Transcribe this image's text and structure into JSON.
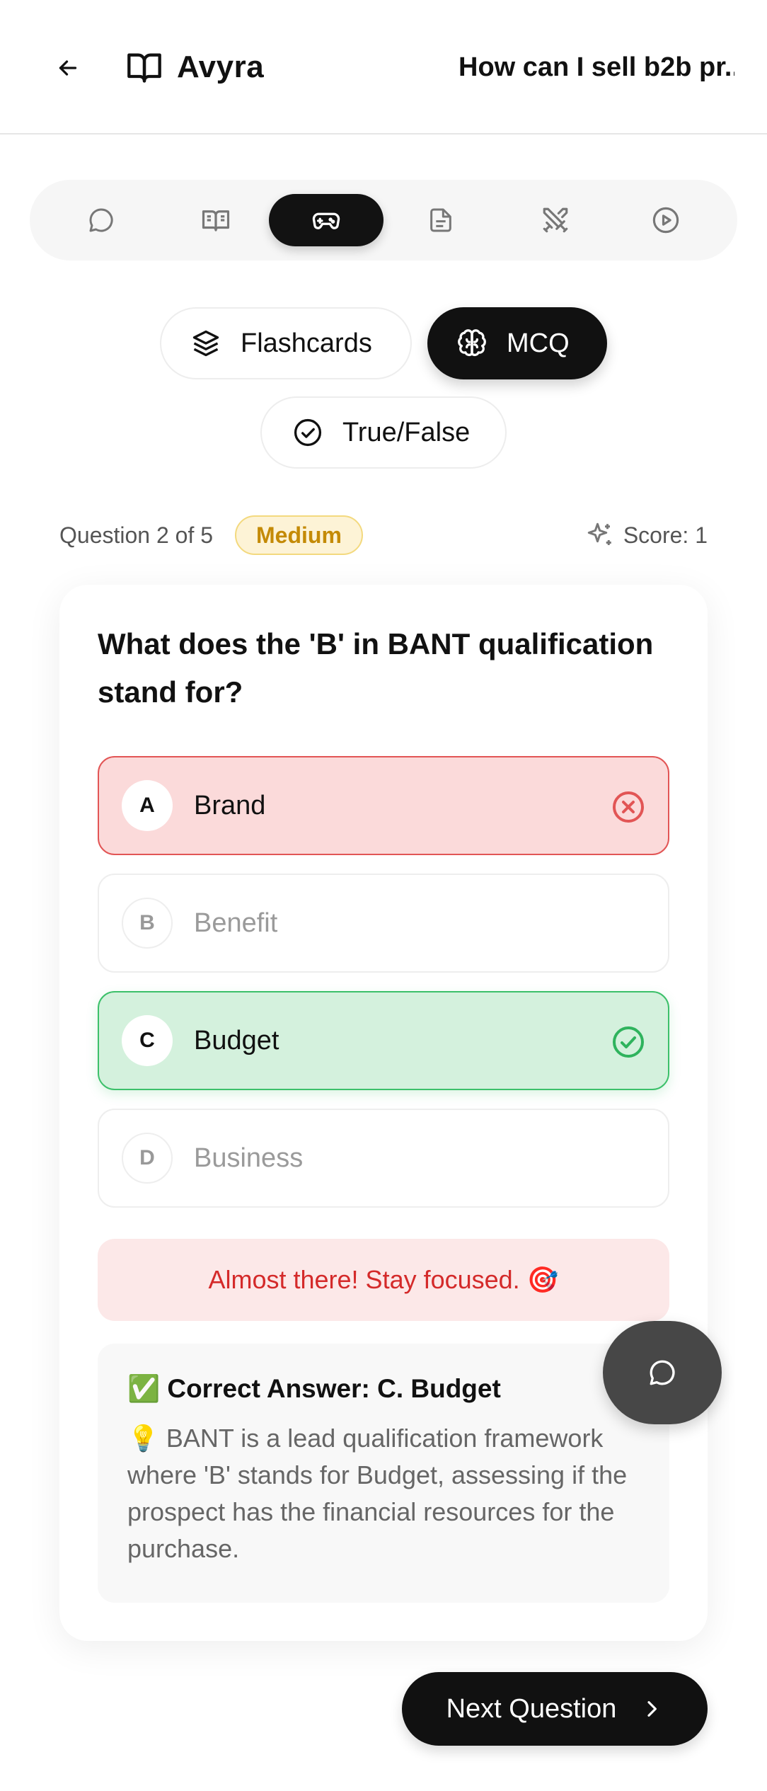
{
  "header": {
    "app_name": "Avyra",
    "conversation_title": "How can I sell b2b pr...",
    "icons": {
      "back": "arrow-left-icon",
      "logo": "open-book-icon"
    }
  },
  "tabs": [
    {
      "icon": "chat-bubble-icon",
      "active": false
    },
    {
      "icon": "book-icon",
      "active": false
    },
    {
      "icon": "gamepad-icon",
      "active": true
    },
    {
      "icon": "document-icon",
      "active": false
    },
    {
      "icon": "crossed-swords-icon",
      "active": false
    },
    {
      "icon": "play-circle-icon",
      "active": false
    }
  ],
  "modes": {
    "flashcards": "Flashcards",
    "mcq": "MCQ",
    "true_false": "True/False",
    "active": "MCQ"
  },
  "quiz": {
    "progress": "Question 2 of 5",
    "difficulty": "Medium",
    "score": "Score: 1",
    "question": "What does the 'B' in BANT qualification stand for?",
    "options": [
      {
        "letter": "A",
        "text": "Brand",
        "state": "wrong"
      },
      {
        "letter": "B",
        "text": "Benefit",
        "state": "neutral"
      },
      {
        "letter": "C",
        "text": "Budget",
        "state": "correct"
      },
      {
        "letter": "D",
        "text": "Business",
        "state": "neutral"
      }
    ],
    "feedback": "Almost there! Stay focused. 🎯",
    "correct_answer": "✅ Correct Answer: C. Budget",
    "explanation": "💡 BANT is a lead qualification framework where 'B' stands for Budget, assessing if the prospect has the financial resources for the purchase.",
    "next_label": "Next Question"
  },
  "colors": {
    "accent_dark": "#111111",
    "wrong": "#e25555",
    "correct": "#3cc06a",
    "difficulty": "#c48a06"
  }
}
